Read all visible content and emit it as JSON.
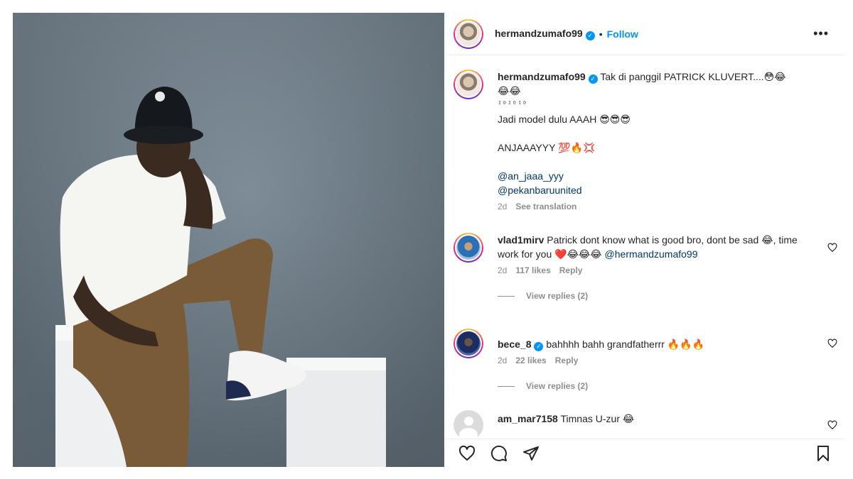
{
  "post": {
    "author": "hermandzumafo99",
    "follow_label": "Follow",
    "separator": "•",
    "more_glyph": "•••"
  },
  "caption": {
    "username": "hermandzumafo99",
    "line1": "Tak di panggil PATRICK KLUVERT....",
    "line1_emoji": "😳😂",
    "line2_emoji": "😂😂",
    "line3": "ᴵᴰᴵᴰᴵᴰ",
    "line4": "Jadi model dulu AAAH",
    "line4_emoji": "😎😎😎",
    "line5": "ANJAAAYYY",
    "line5_emoji": "💯🔥💢",
    "mention1": "@an_jaaa_yyy",
    "mention2": "@pekanbaruunited",
    "age": "2d",
    "see_translation": "See translation"
  },
  "comments": [
    {
      "username": "vlad1mirv",
      "text": "Patrick dont know what is good bro, dont be sad",
      "text2_emoji": "😂",
      "text2": ", time work for you",
      "text2_emoji_b": "❤️😂😂😂",
      "mention": "@hermandzumafo99",
      "age": "2d",
      "likes": "117 likes",
      "reply": "Reply",
      "view_replies": "View replies (2)"
    },
    {
      "username": "bece_8",
      "text": "bahhhh bahh grandfatherrr",
      "emoji": "🔥🔥🔥",
      "age": "2d",
      "likes": "22 likes",
      "reply": "Reply",
      "view_replies": "View replies (2)"
    },
    {
      "username": "am_mar7158",
      "text": "Timnas U-zur",
      "emoji": "😂"
    }
  ],
  "icons": {
    "like": "heart-icon",
    "comment": "comment-icon",
    "share": "send-icon",
    "save": "bookmark-icon"
  },
  "colors": {
    "link_blue": "#0095f6",
    "mention_blue": "#00376b",
    "muted_gray": "#8e8e8e"
  }
}
